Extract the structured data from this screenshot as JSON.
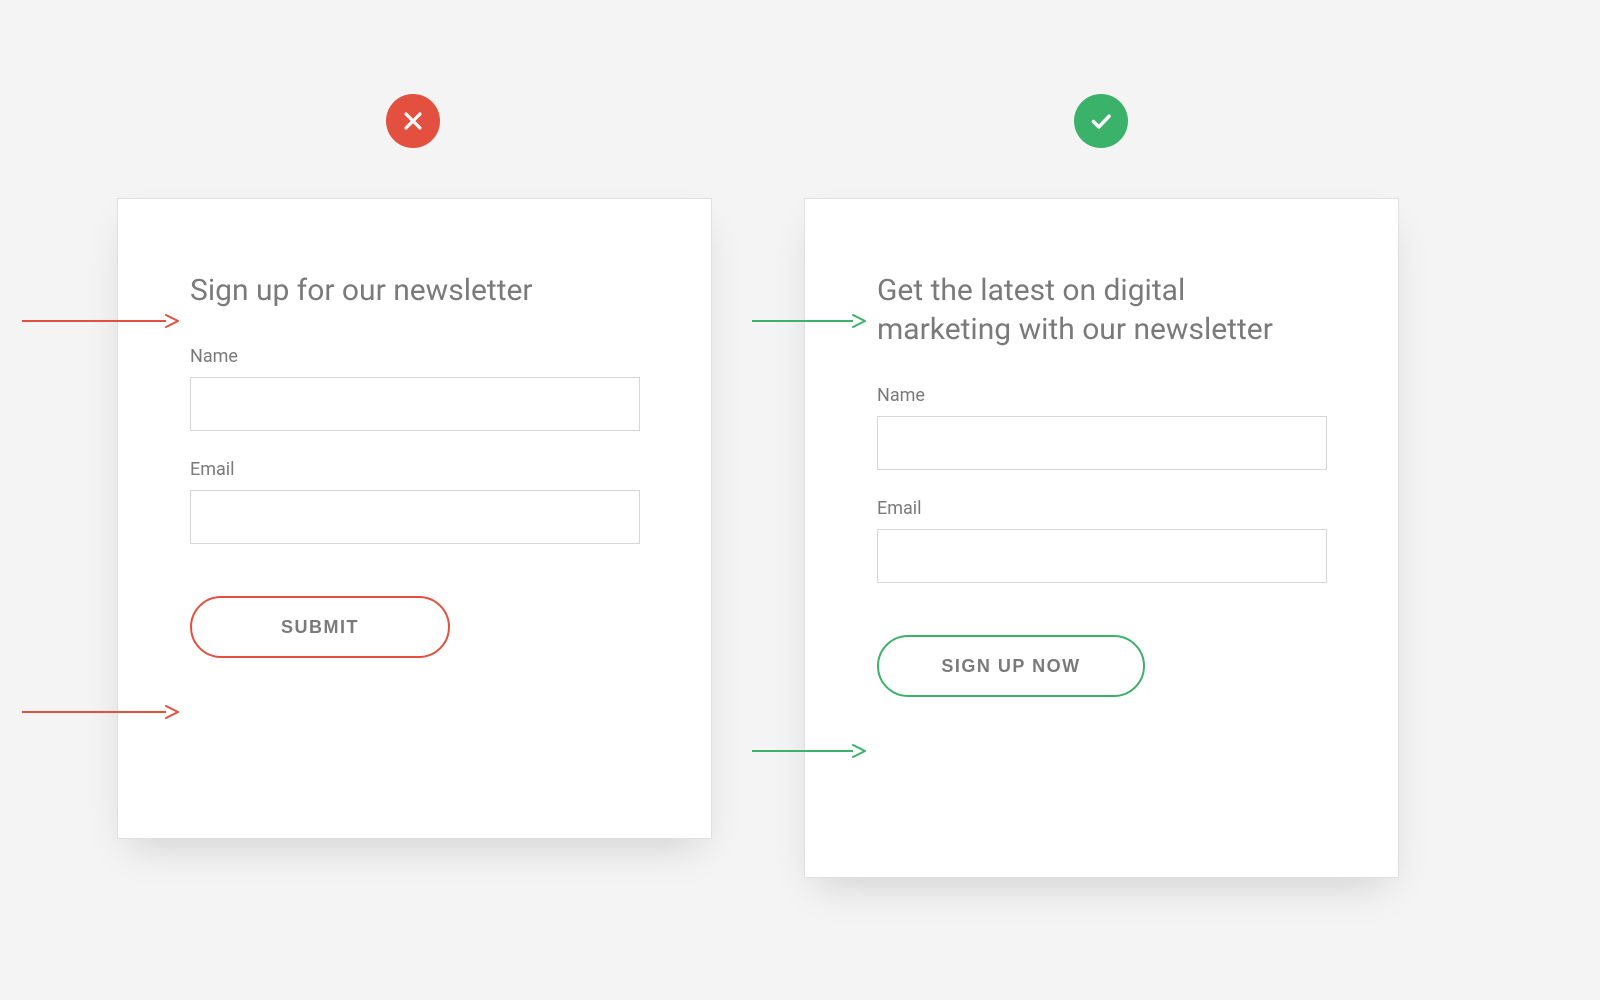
{
  "colors": {
    "red": "#e4503f",
    "green": "#3bb26a",
    "text_muted": "#7a7a7a",
    "border": "#d6d6d6",
    "bg": "#f4f4f4",
    "card_bg": "#ffffff"
  },
  "bad_example": {
    "badge": "x-icon",
    "heading": "Sign up for our newsletter",
    "fields": {
      "name_label": "Name",
      "email_label": "Email"
    },
    "button_label": "SUBMIT"
  },
  "good_example": {
    "badge": "check-icon",
    "heading": "Get the latest on digital marketing with our newsletter",
    "fields": {
      "name_label": "Name",
      "email_label": "Email"
    },
    "button_label": "SIGN UP NOW"
  }
}
